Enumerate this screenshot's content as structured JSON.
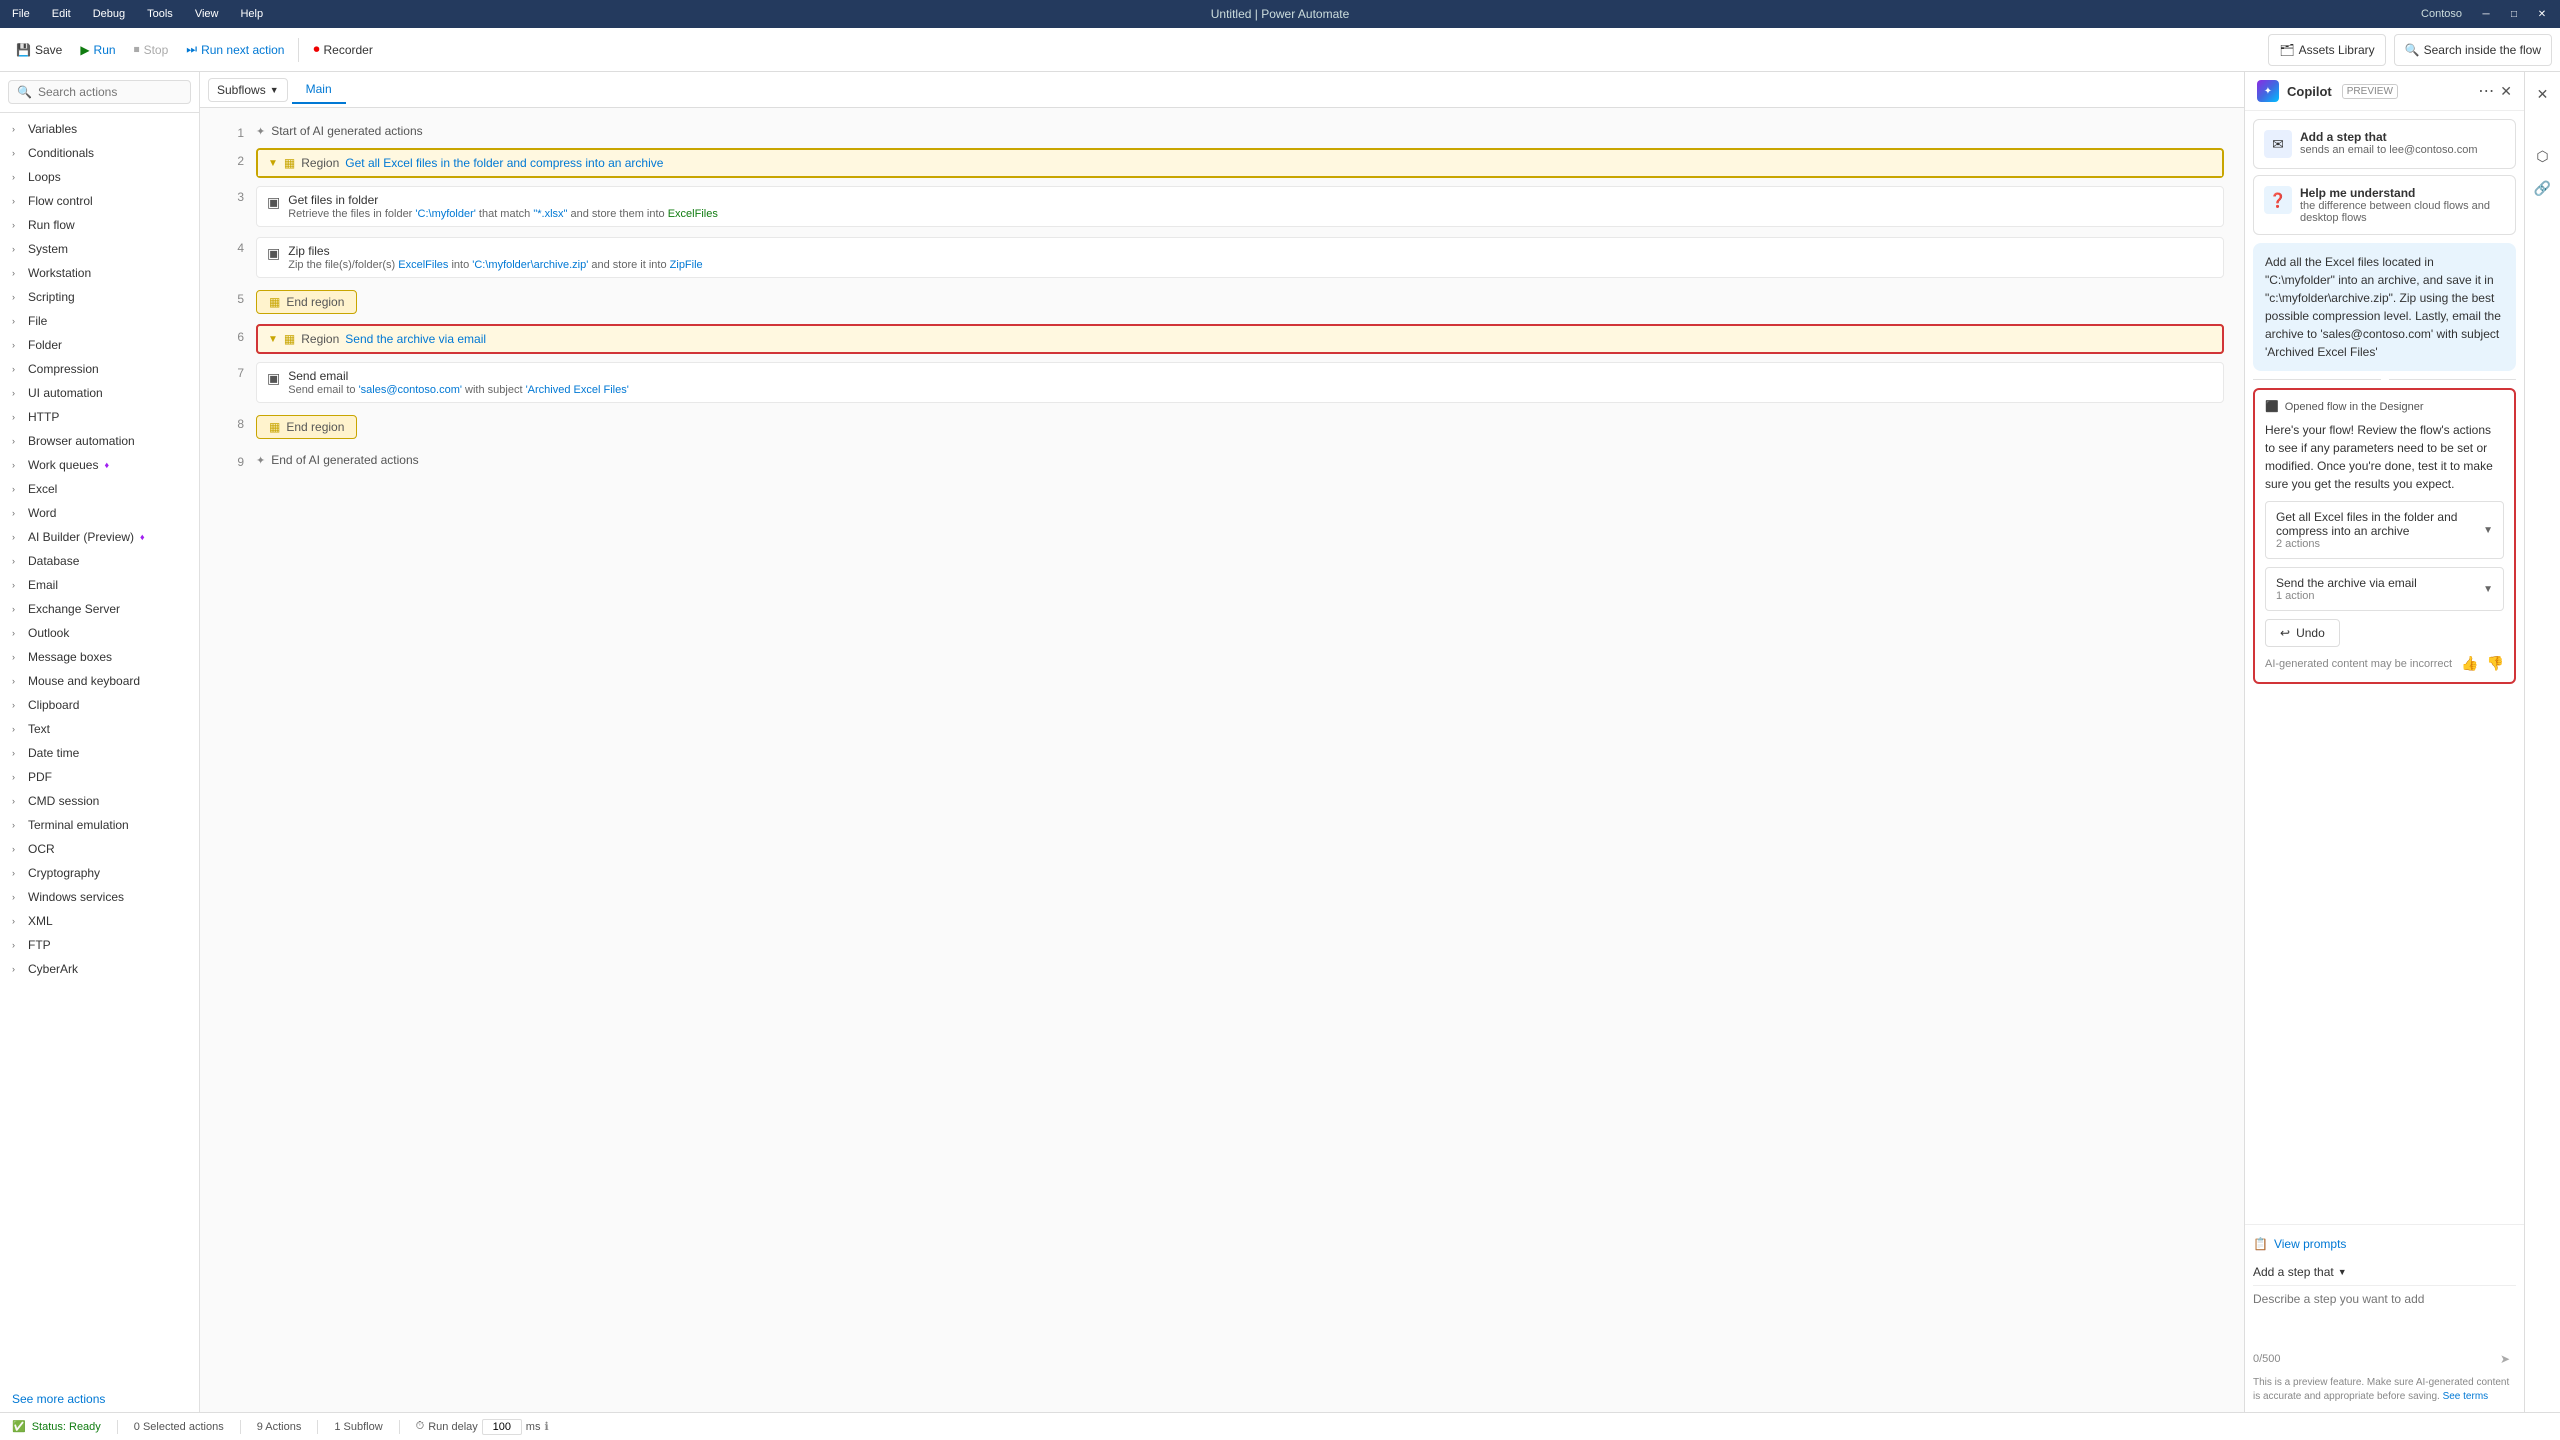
{
  "titlebar": {
    "file": "File",
    "edit": "Edit",
    "debug": "Debug",
    "tools": "Tools",
    "view": "View",
    "help": "Help",
    "app_name": "Untitled | Power Automate",
    "user": "Contoso"
  },
  "toolbar": {
    "save": "Save",
    "run": "Run",
    "stop": "Stop",
    "run_next": "Run next action",
    "recorder": "Recorder",
    "assets_library": "Assets Library",
    "search_flow": "Search inside the flow"
  },
  "sidebar": {
    "search_placeholder": "Search actions",
    "items": [
      {
        "label": "Variables",
        "has_arrow": true
      },
      {
        "label": "Conditionals",
        "has_arrow": true
      },
      {
        "label": "Loops",
        "has_arrow": true
      },
      {
        "label": "Flow control",
        "has_arrow": true
      },
      {
        "label": "Run flow",
        "has_arrow": true
      },
      {
        "label": "System",
        "has_arrow": true
      },
      {
        "label": "Workstation",
        "has_arrow": true
      },
      {
        "label": "Scripting",
        "has_arrow": true
      },
      {
        "label": "File",
        "has_arrow": true
      },
      {
        "label": "Folder",
        "has_arrow": true
      },
      {
        "label": "Compression",
        "has_arrow": true
      },
      {
        "label": "UI automation",
        "has_arrow": true
      },
      {
        "label": "HTTP",
        "has_arrow": true
      },
      {
        "label": "Browser automation",
        "has_arrow": true
      },
      {
        "label": "Work queues",
        "has_arrow": true,
        "has_gem": true
      },
      {
        "label": "Excel",
        "has_arrow": true
      },
      {
        "label": "Word",
        "has_arrow": true
      },
      {
        "label": "AI Builder (Preview)",
        "has_arrow": true,
        "has_gem": true
      },
      {
        "label": "Database",
        "has_arrow": true
      },
      {
        "label": "Email",
        "has_arrow": true
      },
      {
        "label": "Exchange Server",
        "has_arrow": true
      },
      {
        "label": "Outlook",
        "has_arrow": true
      },
      {
        "label": "Message boxes",
        "has_arrow": true
      },
      {
        "label": "Mouse and keyboard",
        "has_arrow": true
      },
      {
        "label": "Clipboard",
        "has_arrow": true
      },
      {
        "label": "Text",
        "has_arrow": true
      },
      {
        "label": "Date time",
        "has_arrow": true
      },
      {
        "label": "PDF",
        "has_arrow": true
      },
      {
        "label": "CMD session",
        "has_arrow": true
      },
      {
        "label": "Terminal emulation",
        "has_arrow": true
      },
      {
        "label": "OCR",
        "has_arrow": true
      },
      {
        "label": "Cryptography",
        "has_arrow": true
      },
      {
        "label": "Windows services",
        "has_arrow": true
      },
      {
        "label": "XML",
        "has_arrow": true
      },
      {
        "label": "FTP",
        "has_arrow": true
      },
      {
        "label": "CyberArk",
        "has_arrow": true
      }
    ],
    "see_more": "See more actions"
  },
  "canvas": {
    "subflows_label": "Subflows",
    "main_tab": "Main",
    "steps": [
      {
        "num": 1,
        "type": "label",
        "text": "Start of AI generated actions"
      },
      {
        "num": 2,
        "type": "region_start",
        "region_name": "Get all Excel files in the folder and compress into an archive",
        "selected": false
      },
      {
        "num": 3,
        "type": "action",
        "title": "Get files in folder",
        "desc_parts": [
          {
            "text": "Retrieve the files in folder "
          },
          {
            "text": "'C:\\myfolder'",
            "highlight": true
          },
          {
            "text": " that match "
          },
          {
            "text": "\"*.xlsx\"",
            "highlight": true
          },
          {
            "text": " and store them into "
          },
          {
            "text": "ExcelFiles",
            "highlight_green": true
          }
        ]
      },
      {
        "num": 4,
        "type": "action",
        "title": "Zip files",
        "desc_parts": [
          {
            "text": "Zip the file(s)/folder(s) "
          },
          {
            "text": "ExcelFiles",
            "highlight": true
          },
          {
            "text": " into "
          },
          {
            "text": "'C:\\myfolder\\archive.zip'",
            "highlight": true
          },
          {
            "text": " and store it into "
          },
          {
            "text": "ZipFile",
            "highlight": true
          }
        ]
      },
      {
        "num": 5,
        "type": "end_region"
      },
      {
        "num": 6,
        "type": "region_start",
        "region_name": "Send the archive via email",
        "selected": true
      },
      {
        "num": 7,
        "type": "action",
        "title": "Send email",
        "desc_parts": [
          {
            "text": "Send email to "
          },
          {
            "text": "'sales@contoso.com'",
            "highlight": true
          },
          {
            "text": " with subject "
          },
          {
            "text": "'Archived Excel Files'",
            "highlight": true
          }
        ]
      },
      {
        "num": 8,
        "type": "end_region"
      },
      {
        "num": 9,
        "type": "label",
        "text": "End of AI generated actions"
      }
    ]
  },
  "copilot": {
    "title": "Copilot",
    "preview_label": "PREVIEW",
    "suggestions": [
      {
        "icon": "✉",
        "bold": "Add a step that",
        "sub": "sends an email to lee@contoso.com"
      },
      {
        "icon": "❓",
        "bold": "Help me understand",
        "sub": "the difference between cloud flows and desktop flows"
      }
    ],
    "ai_message": "Add all the Excel files located in \"C:\\myfolder\" into an archive, and save it in \"c:\\myfolder\\archive.zip\". Zip using the best possible compression level. Lastly, email the archive to 'sales@contoso.com' with subject 'Archived Excel Files'",
    "opened_flow_label": "Opened flow in the Designer",
    "opened_flow_message": "Here's your flow! Review the flow's actions to see if any parameters need to be set or modified. Once you're done, test it to make sure you get the results you expect.",
    "flow_groups": [
      {
        "title": "Get all Excel files in the folder and compress into an archive",
        "meta": "2 actions"
      },
      {
        "title": "Send the archive via email",
        "meta": "1 action"
      }
    ],
    "undo_label": "Undo",
    "disclaimer": "AI-generated content may be incorrect",
    "view_prompts": "View prompts",
    "add_step": "Add a step that",
    "step_input_placeholder": "Describe a step you want to add",
    "char_count": "0/500",
    "preview_note": "This is a preview feature. Make sure AI-generated content is accurate and appropriate before saving.",
    "see_terms": "See terms"
  },
  "statusbar": {
    "status": "Status: Ready",
    "selected_actions": "0 Selected actions",
    "total_actions": "9 Actions",
    "subflows": "1 Subflow",
    "run_delay_label": "Run delay",
    "delay_value": "100",
    "delay_unit": "ms"
  }
}
